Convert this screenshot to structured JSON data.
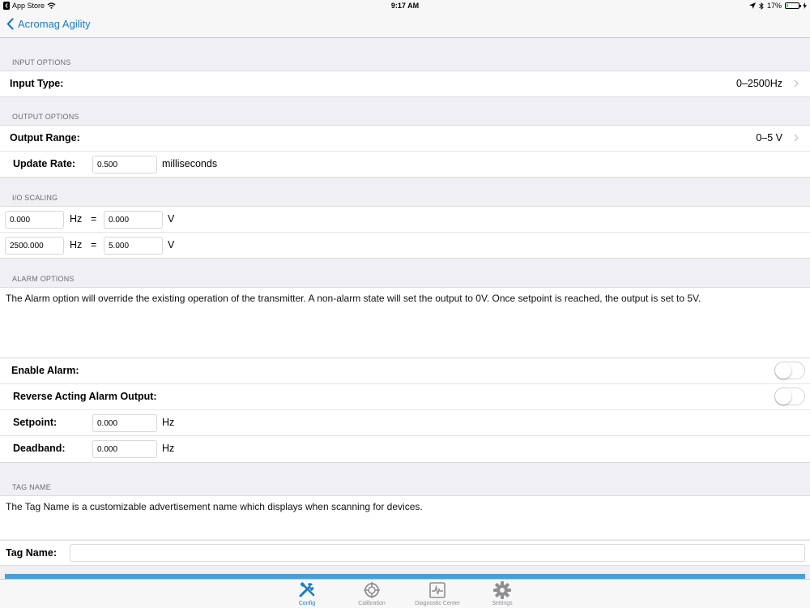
{
  "statusbar": {
    "carrier": "App Store",
    "time": "9:17 AM",
    "battery": "17%",
    "battery_level": 0.17
  },
  "nav": {
    "back_label": "Acromag Agility"
  },
  "input_options": {
    "header": "INPUT OPTIONS",
    "input_type_label": "Input Type:",
    "input_type_value": "0–2500Hz"
  },
  "output_options": {
    "header": "OUTPUT OPTIONS",
    "output_range_label": "Output Range:",
    "output_range_value": "0–5 V",
    "update_rate_label": "Update Rate:",
    "update_rate_value": "0.500",
    "update_rate_unit": "milliseconds"
  },
  "io_scaling": {
    "header": "I/O SCALING",
    "rows": [
      {
        "input": "0.000",
        "input_unit": "Hz",
        "equals": "=",
        "output": "0.000",
        "output_unit": "V"
      },
      {
        "input": "2500.000",
        "input_unit": "Hz",
        "equals": "=",
        "output": "5.000",
        "output_unit": "V"
      }
    ]
  },
  "alarm_options": {
    "header": "ALARM OPTIONS",
    "description": "The Alarm option will override the existing operation of the transmitter.  A non-alarm state will set the output to 0V.  Once setpoint is reached, the output is set to 5V.",
    "enable_label": "Enable Alarm:",
    "reverse_label": "Reverse Acting Alarm Output:",
    "setpoint_label": "Setpoint:",
    "setpoint_value": "0.000",
    "setpoint_unit": "Hz",
    "deadband_label": "Deadband:",
    "deadband_value": "0.000",
    "deadband_unit": "Hz"
  },
  "tag_name": {
    "header": "TAG NAME",
    "description": "The Tag Name is a customizable advertisement name which displays when scanning for devices.",
    "label": "Tag Name:",
    "value": ""
  },
  "tabs": [
    {
      "label": "Config",
      "icon": "tools-icon",
      "active": true
    },
    {
      "label": "Calibration",
      "icon": "crosshair-icon",
      "active": false
    },
    {
      "label": "Diagnostic Center",
      "icon": "waveform-icon",
      "active": false
    },
    {
      "label": "Settings",
      "icon": "gear-icon",
      "active": false
    }
  ],
  "colors": {
    "accent": "#1a7dc0",
    "strip": "#4a9ed6",
    "background": "#efeff4"
  }
}
